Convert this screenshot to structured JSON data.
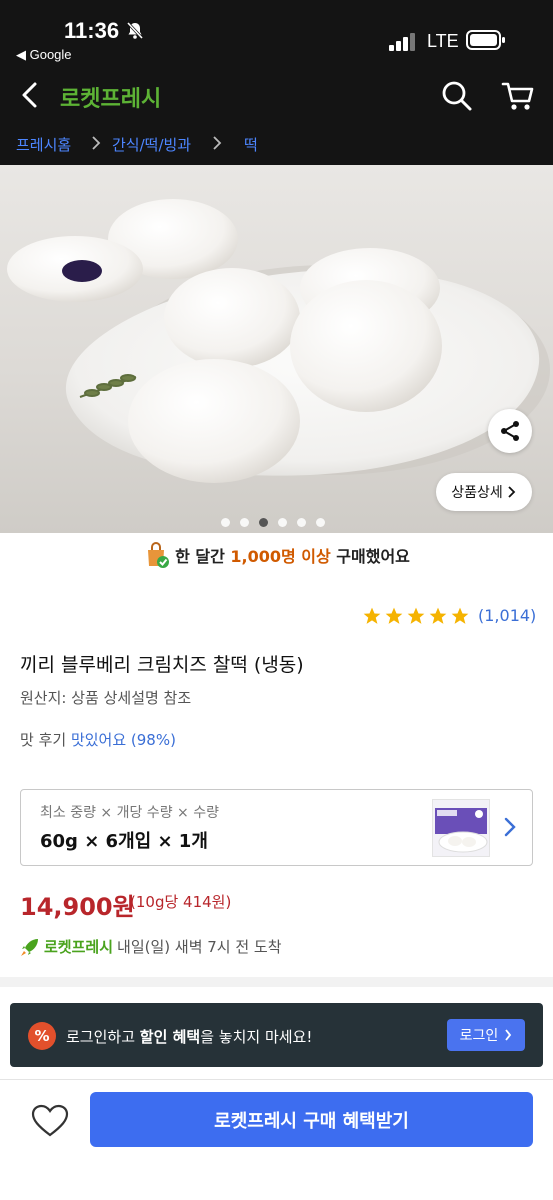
{
  "status_bar": {
    "time": "11:36",
    "back_app": "◀ Google",
    "network": "LTE"
  },
  "header": {
    "brand": "로켓프레시"
  },
  "breadcrumb": [
    "프레시홈",
    "간식/떡/빙과",
    "떡"
  ],
  "hero": {
    "detail_label": "상품상세",
    "image_count": 6,
    "active_index": 2
  },
  "purchase_info": {
    "prefix": "한 달간 ",
    "highlight": "1,000명 이상",
    "suffix": " 구매했어요"
  },
  "rating": {
    "stars": 5,
    "count": "(1,014)"
  },
  "product": {
    "title": "끼리 블루베리 크림치즈 찰떡 (냉동)",
    "origin": "원산지: 상품 상세설명 참조",
    "taste_prefix": "맛 후기 ",
    "taste_value": "맛있어요 (98%)"
  },
  "option": {
    "label": "최소 중량 × 개당 수량 × 수량",
    "value": "60g × 6개입 × 1개"
  },
  "price": {
    "amount": "14,900원",
    "unit": "(10g당 414원)"
  },
  "delivery": {
    "brand": "로켓프레시",
    "text": " 내일(일) 새벽 7시 전  도착"
  },
  "login_banner": {
    "icon_text": "%",
    "prefix": "로그인하고 ",
    "bold": "할인 혜택",
    "suffix": "을 놓치지 마세요!",
    "button": "로그인"
  },
  "bottom_bar": {
    "buy_label": "로켓프레시 구매 혜택받기"
  },
  "colors": {
    "brand_green": "#5db335",
    "link_blue": "#4d86ff",
    "price_red": "#b8262b",
    "buy_blue": "#3d6df0",
    "banner_dark": "#263238"
  }
}
